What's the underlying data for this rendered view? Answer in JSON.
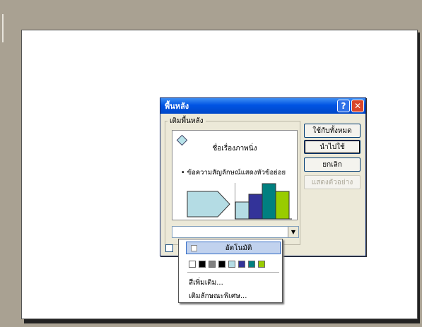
{
  "dialog": {
    "title": "พื้นหลัง",
    "group_label": "เติมพื้นหลัง",
    "buttons": {
      "apply_all": "ใช้กับทั้งหมด",
      "apply": "นำไปใช้",
      "cancel": "ยกเลิก",
      "preview": "แสดงตัวอย่าง"
    },
    "preview": {
      "title": "ชื่อเรื่องภาพนิ่ง",
      "bullet": "• ข้อความสัญลักษณ์แสดงหัวข้อย่อย"
    }
  },
  "dropdown": {
    "auto_label": "อัตโนมัติ",
    "more_colors": "สีเพิ่มเติม...",
    "fill_effects": "เติมลักษณะพิเศษ...",
    "swatches": [
      "#ffffff",
      "#000000",
      "#808080",
      "#000000",
      "#b4dce4",
      "#333399",
      "#008080",
      "#99cc00"
    ]
  },
  "colors": {
    "chart_bars": [
      "#b4dce4",
      "#333399",
      "#008080",
      "#99cc00"
    ],
    "shape_fill": "#b4dce4"
  }
}
